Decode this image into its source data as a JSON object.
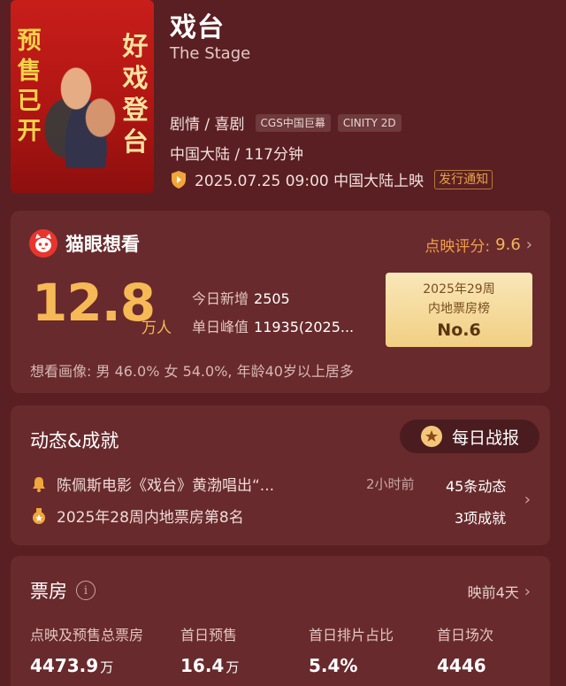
{
  "movie": {
    "title": "戏台",
    "subtitle": "The Stage",
    "genre": "剧情 / 喜剧",
    "tags": [
      "CGS中国巨幕",
      "CINITY 2D"
    ],
    "region_duration": "中国大陆 / 117分钟",
    "release": "2025.07.25 09:00 中国大陆上映",
    "notify_label": "发行通知",
    "poster": {
      "left_text": "预售已开",
      "right_text": "好戏登台"
    }
  },
  "want": {
    "title": "猫眼想看",
    "rating_label": "点映评分:",
    "rating_value": "9.6",
    "count": "12.8",
    "count_unit": "万人",
    "today_label": "今日新增",
    "today_value": "2505",
    "peak_label": "单日峰值",
    "peak_value": "11935(2025...",
    "rank_line1": "2025年29周",
    "rank_line2": "内地票房榜",
    "rank_no": "No.6",
    "portrait": "想看画像: 男 46.0% 女 54.0%, 年龄40岁以上居多"
  },
  "dynamics": {
    "title": "动态&成就",
    "daily_button": "每日战报",
    "news": "陈佩斯电影《戏台》黄渤唱出“...",
    "news_time": "2小时前",
    "news_count": "45条动态",
    "achievement": "2025年28周内地票房第8名",
    "achievement_count": "3项成就"
  },
  "boxoffice": {
    "title": "票房",
    "days_label": "映前4天",
    "columns": [
      {
        "label": "点映及预售总票房",
        "value": "4473.9",
        "unit": "万"
      },
      {
        "label": "首日预售",
        "value": "16.4",
        "unit": "万"
      },
      {
        "label": "首日排片占比",
        "value": "5.4%",
        "unit": ""
      },
      {
        "label": "首日场次",
        "value": "4446",
        "unit": ""
      }
    ]
  },
  "colors": {
    "background": "#5a1f22",
    "card": "#682a2c",
    "accent_orange": "#f6b955",
    "rating_orange": "#ef9d4c",
    "rank_gold": "#f1cf83"
  }
}
